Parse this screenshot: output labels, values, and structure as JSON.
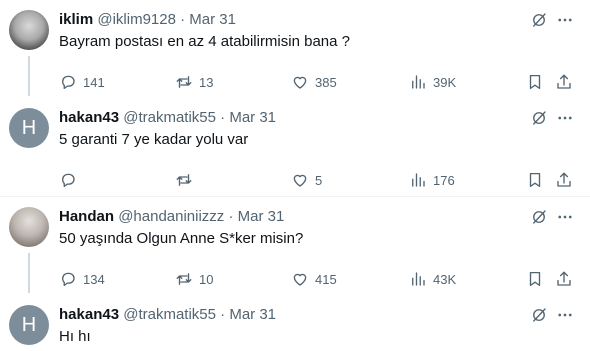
{
  "tweets": [
    {
      "name": "iklim",
      "handle": "@iklim9128",
      "dot": "·",
      "date": "Mar 31",
      "text": "Bayram postası en az 4 atabilirmisin bana ?",
      "avatar_letter": "",
      "replies": "141",
      "retweets": "13",
      "likes": "385",
      "views": "39K"
    },
    {
      "name": "hakan43",
      "handle": "@trakmatik55",
      "dot": "·",
      "date": "Mar 31",
      "text": "5 garanti 7 ye kadar yolu var",
      "avatar_letter": "H",
      "replies": "",
      "retweets": "",
      "likes": "5",
      "views": "176"
    },
    {
      "name": "Handan",
      "handle": "@handaniniizzz",
      "dot": "·",
      "date": "Mar 31",
      "text": "50 yaşında Olgun Anne S*ker misin?",
      "avatar_letter": "",
      "replies": "134",
      "retweets": "10",
      "likes": "415",
      "views": "43K"
    },
    {
      "name": "hakan43",
      "handle": "@trakmatik55",
      "dot": "·",
      "date": "Mar 31",
      "text": "Hı hı",
      "avatar_letter": "H"
    }
  ],
  "icons": {
    "grok": "grok-icon",
    "more": "more-icon",
    "reply": "reply-icon",
    "retweet": "retweet-icon",
    "like": "like-icon",
    "views": "views-icon",
    "bookmark": "bookmark-icon",
    "share": "share-icon"
  },
  "colors": {
    "secondary_text": "#536471",
    "primary_text": "#0f1419",
    "thread_line": "#cfd9de",
    "avatar_letter_bg": "#7d8d9a"
  }
}
